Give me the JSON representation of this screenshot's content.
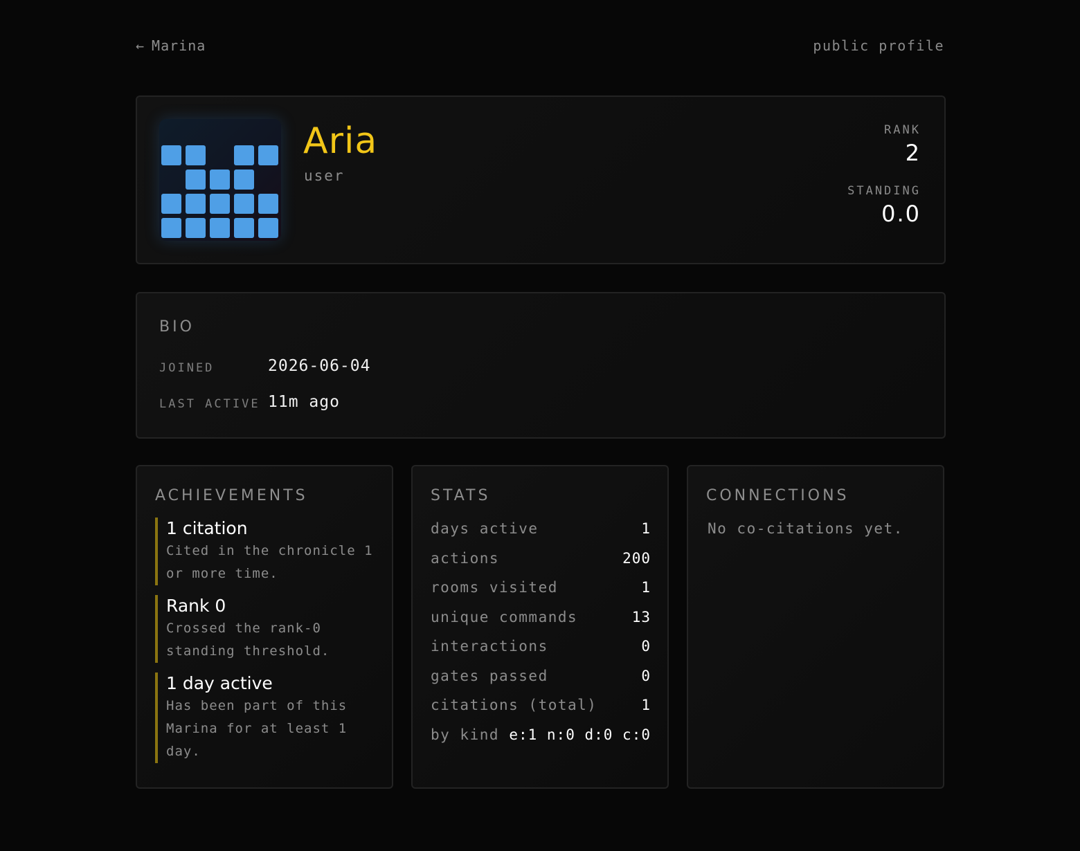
{
  "topbar": {
    "back_arrow": "←",
    "back_label": "Marina",
    "page_label": "public profile"
  },
  "profile": {
    "name": "Aria",
    "role": "user",
    "avatar_color": "#4f9fe6",
    "name_color": "#f2c618",
    "rank_label": "RANK",
    "rank_value": "2",
    "standing_label": "STANDING",
    "standing_value": "0.0"
  },
  "bio": {
    "title": "BIO",
    "rows": [
      {
        "label": "JOINED",
        "value": "2026-06-04"
      },
      {
        "label": "LAST ACTIVE",
        "value": "11m ago"
      }
    ]
  },
  "achievements": {
    "title": "ACHIEVEMENTS",
    "accent_color": "#8a7410",
    "items": [
      {
        "title": "1 citation",
        "desc_lines": [
          "Cited in the chronicle 1",
          "or more time."
        ]
      },
      {
        "title": "Rank 0",
        "desc_lines": [
          "Crossed the rank-0",
          "standing threshold."
        ]
      },
      {
        "title": "1 day active",
        "desc_lines": [
          "Has been part of this",
          "Marina for at least 1",
          "day."
        ]
      }
    ]
  },
  "stats": {
    "title": "STATS",
    "rows": [
      {
        "label": "days active",
        "value": "1"
      },
      {
        "label": "actions",
        "value": "200"
      },
      {
        "label": "rooms visited",
        "value": "1"
      },
      {
        "label": "unique commands",
        "value": "13"
      },
      {
        "label": "interactions",
        "value": "0"
      },
      {
        "label": "gates passed",
        "value": "0"
      },
      {
        "label": "citations (total)",
        "value": "1"
      },
      {
        "label": "by kind",
        "value": "e:1 n:0 d:0 c:0"
      }
    ]
  },
  "connections": {
    "title": "CONNECTIONS",
    "empty_text": "No co-citations yet."
  }
}
